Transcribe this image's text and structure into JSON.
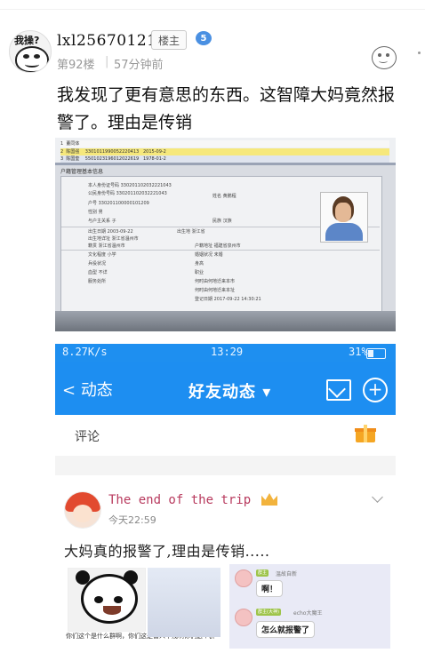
{
  "post": {
    "avatar_text": "我操?",
    "username": "lxl25670121...",
    "op_badge": "楼主",
    "level": "5",
    "floor": "第92楼",
    "separator": "|",
    "time": "57分钟前",
    "body": "我发现了更有意思的东西。这智障大妈竟然报警了。理由是传销"
  },
  "photo1": {
    "rows": [
      {
        "num": "1",
        "name": "董同体",
        "id": "",
        "count": ""
      },
      {
        "num": "2",
        "name": "陈国强",
        "id": "3301011990052220413",
        "count": "2015-09-2"
      },
      {
        "num": "3",
        "name": "陈国奎",
        "id": "5501023196012022619",
        "count": "1978-01-2"
      }
    ],
    "panel_title": "户籍管理基本信息",
    "fields": [
      "本人身份证号码 330201102032221043",
      "公民身份号码 330201102032221043",
      "姓名 黄鹏程",
      "户号 330201100000101209",
      "性别 男",
      "与户主关系 子",
      "民族 汉族",
      "出生日期 2003-09-22",
      "出生地 浙江省",
      "出生地详址 浙江省温州市",
      "籍贯 浙江省温州市",
      "户籍地址 福建省泉州市",
      "文化程度 小学",
      "婚姻状况 未婚",
      "兵役状况",
      "身高",
      "血型 不详",
      "职业",
      "服务处所",
      "何时由何地迁来本市",
      "何时由何地迁来本址",
      "登记日期 2017-09-22 14:30:21"
    ]
  },
  "phone": {
    "status_left": "8.27K/s",
    "status_time": "13:29",
    "status_battery": "31%",
    "back_label": "动态",
    "title": "好友动态",
    "comment_label": "评论",
    "card": {
      "name": "The end of the trip",
      "time": "今天22:59",
      "text": "大妈真的报警了,理由是传销.....",
      "meme_caption": "你们这个是什么群啊，你们这是害人不浅啊你们这个群",
      "chat": [
        {
          "tag": "群主",
          "name": "温故自新",
          "text": "啊！"
        },
        {
          "tag": "群主(大神)",
          "name": "echo大魔王",
          "text": "怎么就报警了"
        }
      ]
    }
  },
  "colors": {
    "accent_blue": "#1d8ef1",
    "level_blue": "#4a90e2",
    "name_pink": "#b83a5e"
  }
}
